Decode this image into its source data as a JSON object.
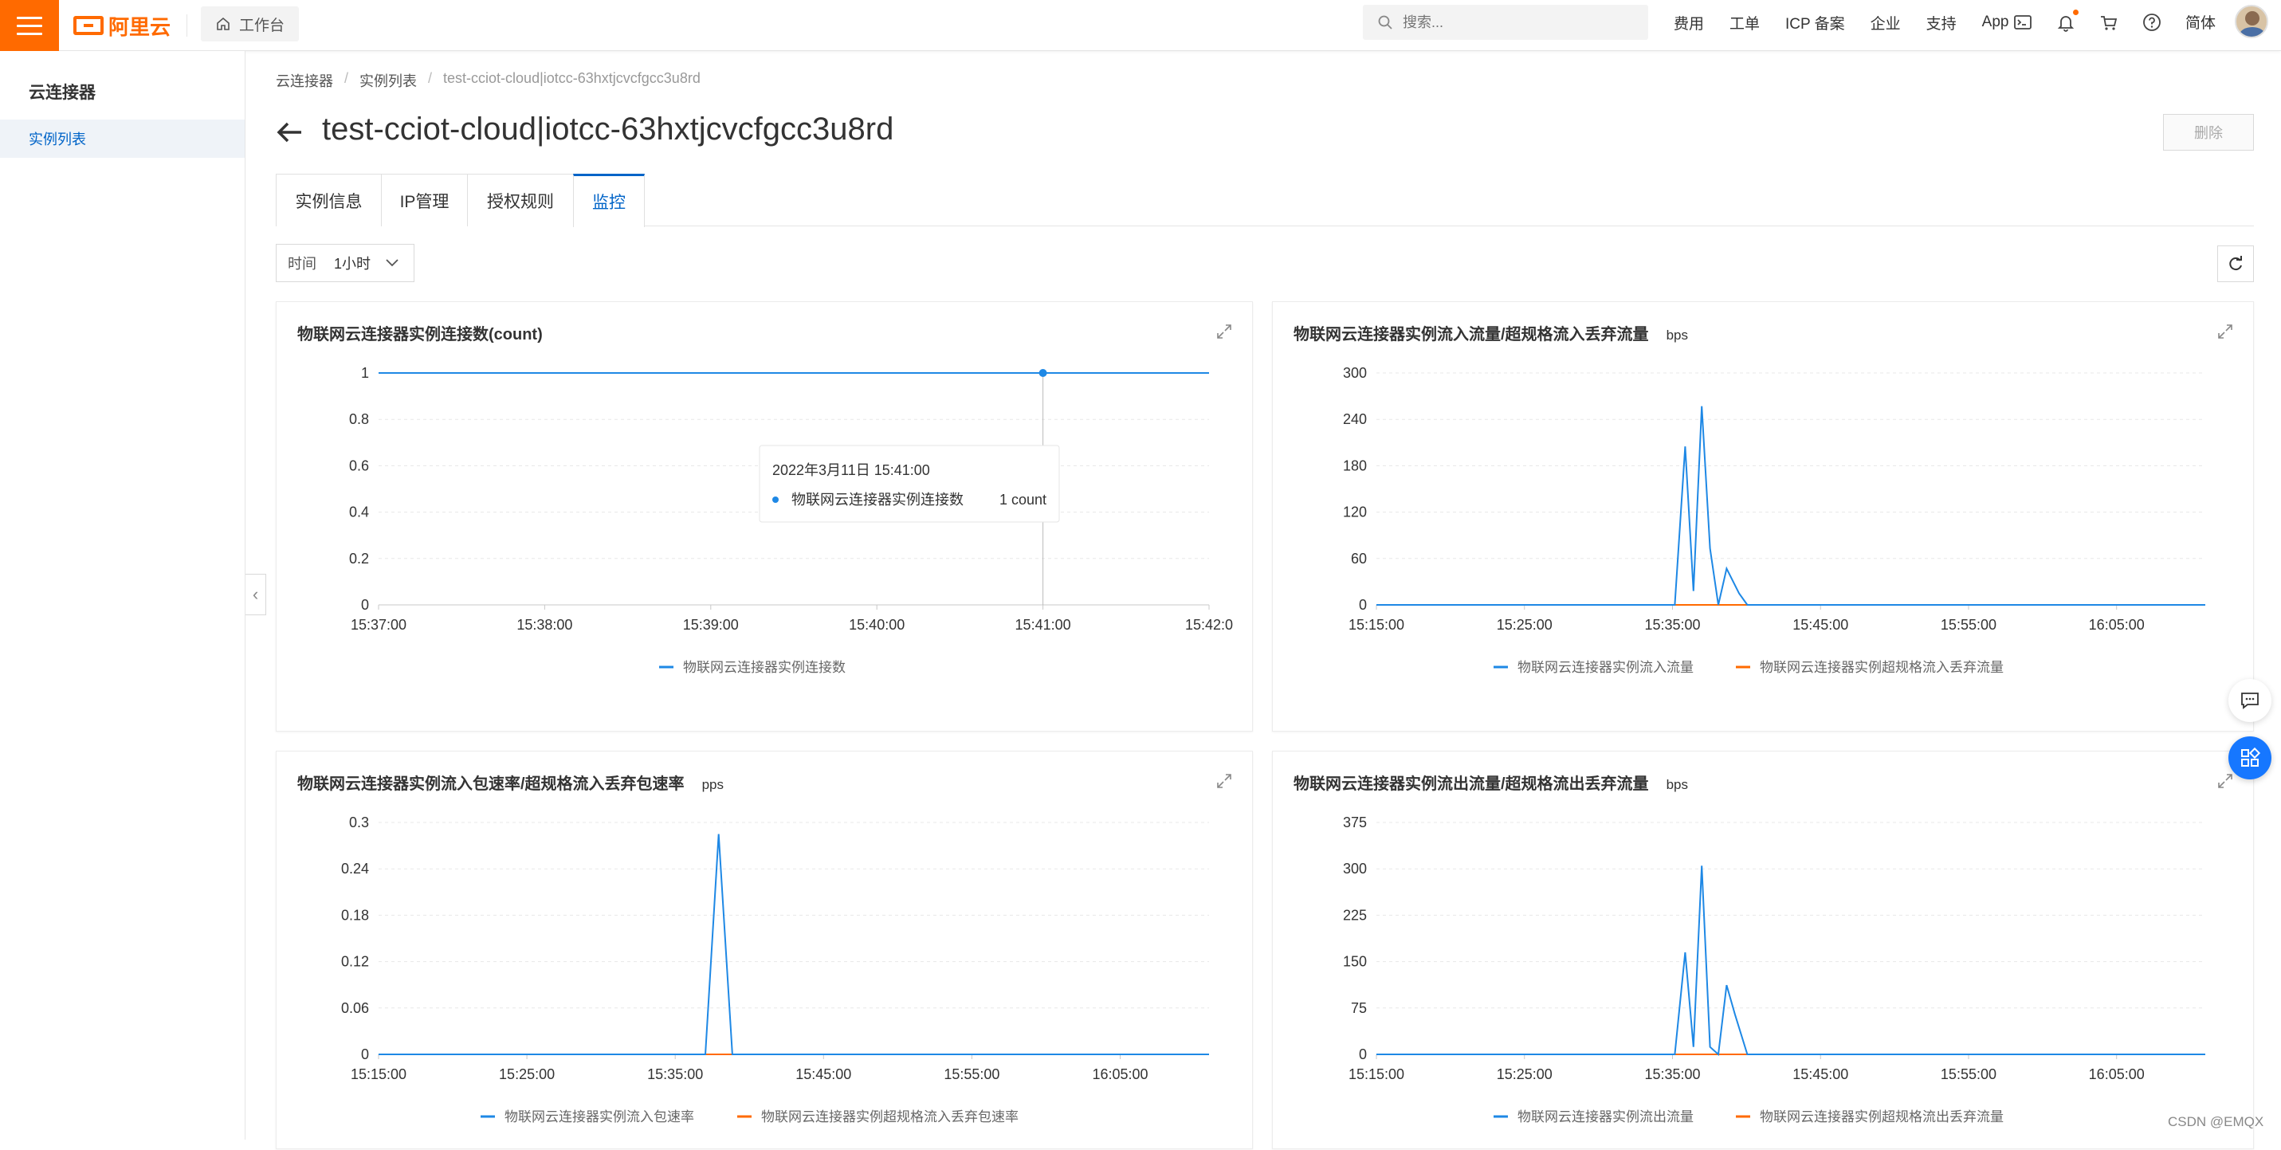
{
  "topbar": {
    "brand": "阿里云",
    "workbench_label": "工作台",
    "search_placeholder": "搜索...",
    "links": [
      "费用",
      "工单",
      "ICP 备案",
      "企业",
      "支持",
      "App"
    ],
    "language": "简体",
    "icons": [
      "terminal-icon",
      "bell-icon",
      "cart-icon",
      "help-icon"
    ],
    "accent_color": "#ff6a00"
  },
  "sidebar": {
    "title": "云连接器",
    "items": [
      {
        "label": "实例列表",
        "active": true
      }
    ]
  },
  "breadcrumb": [
    "云连接器",
    "实例列表",
    "test-cciot-cloud|iotcc-63hxtjcvcfgcc3u8rd"
  ],
  "page": {
    "title": "test-cciot-cloud|iotcc-63hxtjcvcfgcc3u8rd",
    "delete_label": "删除"
  },
  "tabs": [
    {
      "label": "实例信息",
      "active": false
    },
    {
      "label": "IP管理",
      "active": false
    },
    {
      "label": "授权规则",
      "active": false
    },
    {
      "label": "监控",
      "active": true
    }
  ],
  "filter": {
    "time_label": "时间",
    "time_value": "1小时"
  },
  "tooltip": {
    "time": "2022年3月11日 15:41:00",
    "series": "物联网云连接器实例连接数",
    "value": "1 count"
  },
  "colors": {
    "series_blue": "#1e88e5",
    "series_orange": "#ff6a00",
    "link_blue": "#0064c8"
  },
  "watermark": "CSDN @EMQX",
  "chart_data": [
    {
      "type": "line",
      "title": "物联网云连接器实例连接数(count)",
      "unit": "",
      "x_ticks": [
        "15:37:00",
        "15:38:00",
        "15:39:00",
        "15:40:00",
        "15:41:00",
        "15:42:0"
      ],
      "y_ticks": [
        "0",
        "0.2",
        "0.4",
        "0.6",
        "0.8",
        "1"
      ],
      "ylim": [
        0,
        1
      ],
      "x": [
        "15:37:00",
        "15:42:00"
      ],
      "series": [
        {
          "name": "物联网云连接器实例连接数",
          "color": "#1e88e5",
          "points": [
            [
              0,
              1
            ],
            [
              1,
              1
            ]
          ]
        }
      ],
      "highlight": {
        "x": "15:41:00",
        "y": 1
      }
    },
    {
      "type": "line",
      "title": "物联网云连接器实例流入流量/超规格流入丢弃流量",
      "unit": "bps",
      "x_ticks": [
        "15:15:00",
        "15:25:00",
        "15:35:00",
        "15:45:00",
        "15:55:00",
        "16:05:00"
      ],
      "y_ticks": [
        "0",
        "60",
        "120",
        "180",
        "240",
        "300"
      ],
      "ylim": [
        0,
        300
      ],
      "series": [
        {
          "name": "物联网云连接器实例流入流量",
          "color": "#1e88e5",
          "points": [
            [
              0,
              0
            ],
            [
              0.36,
              0
            ],
            [
              0.3725,
              205
            ],
            [
              0.3825,
              18
            ],
            [
              0.3925,
              257
            ],
            [
              0.4025,
              73
            ],
            [
              0.4125,
              0
            ],
            [
              0.4225,
              47
            ],
            [
              0.4375,
              15
            ],
            [
              0.4475,
              0
            ],
            [
              1,
              0
            ]
          ]
        },
        {
          "name": "物联网云连接器实例超规格流入丢弃流量",
          "color": "#ff6a00",
          "points": [
            [
              0,
              0
            ],
            [
              1,
              0
            ]
          ]
        }
      ]
    },
    {
      "type": "line",
      "title": "物联网云连接器实例流入包速率/超规格流入丢弃包速率",
      "unit": "pps",
      "x_ticks": [
        "15:15:00",
        "15:25:00",
        "15:35:00",
        "15:45:00",
        "15:55:00",
        "16:05:00"
      ],
      "y_ticks": [
        "0",
        "0.06",
        "0.12",
        "0.18",
        "0.24",
        "0.3"
      ],
      "ylim": [
        0,
        0.3
      ],
      "series": [
        {
          "name": "物联网云连接器实例流入包速率",
          "color": "#1e88e5",
          "points": [
            [
              0,
              0
            ],
            [
              0.3935,
              0
            ],
            [
              0.4095,
              0.285
            ],
            [
              0.426,
              0
            ],
            [
              1,
              0
            ]
          ]
        },
        {
          "name": "物联网云连接器实例超规格流入丢弃包速率",
          "color": "#ff6a00",
          "points": [
            [
              0,
              0
            ],
            [
              1,
              0
            ]
          ]
        }
      ]
    },
    {
      "type": "line",
      "title": "物联网云连接器实例流出流量/超规格流出丢弃流量",
      "unit": "bps",
      "x_ticks": [
        "15:15:00",
        "15:25:00",
        "15:35:00",
        "15:45:00",
        "15:55:00",
        "16:05:00"
      ],
      "y_ticks": [
        "0",
        "75",
        "150",
        "225",
        "300",
        "375"
      ],
      "ylim": [
        0,
        375
      ],
      "series": [
        {
          "name": "物联网云连接器实例流出流量",
          "color": "#1e88e5",
          "points": [
            [
              0,
              0
            ],
            [
              0.36,
              0
            ],
            [
              0.3725,
              165
            ],
            [
              0.3825,
              12
            ],
            [
              0.3925,
              305
            ],
            [
              0.4025,
              12
            ],
            [
              0.4125,
              0
            ],
            [
              0.4225,
              112
            ],
            [
              0.4325,
              65
            ],
            [
              0.4475,
              0
            ],
            [
              1,
              0
            ]
          ]
        },
        {
          "name": "物联网云连接器实例超规格流出丢弃流量",
          "color": "#ff6a00",
          "points": [
            [
              0,
              0
            ],
            [
              1,
              0
            ]
          ]
        }
      ]
    }
  ]
}
